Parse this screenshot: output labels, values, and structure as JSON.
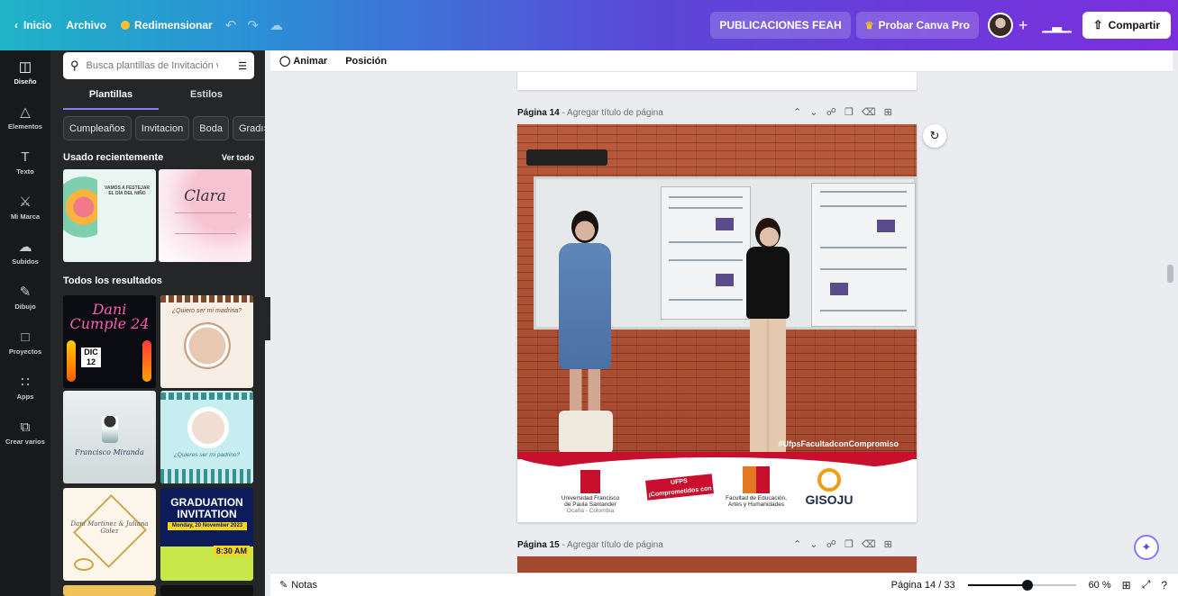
{
  "topbar": {
    "home": "Inicio",
    "file": "Archivo",
    "resize": "Redimensionar",
    "undo_icon": "undo-icon",
    "redo_icon": "redo-icon",
    "save_icon": "cloud-check-icon",
    "project_name": "PUBLICACIONES FEAH",
    "pro": "Probar Canva Pro",
    "share": "Compartir",
    "accent_gradient": [
      "#1fb3c7",
      "#5b47d8",
      "#7b2fdc"
    ]
  },
  "rail": {
    "items": [
      {
        "label": "Diseño",
        "icon": "layout-icon"
      },
      {
        "label": "Elementos",
        "icon": "shapes-icon"
      },
      {
        "label": "Texto",
        "icon": "text-icon"
      },
      {
        "label": "Mi Marca",
        "icon": "brand-icon"
      },
      {
        "label": "Subidos",
        "icon": "upload-icon"
      },
      {
        "label": "Dibujo",
        "icon": "draw-icon"
      },
      {
        "label": "Proyectos",
        "icon": "folder-icon"
      },
      {
        "label": "Apps",
        "icon": "apps-icon"
      },
      {
        "label": "Crear varios",
        "icon": "create-multiple-icon"
      }
    ]
  },
  "panel": {
    "search_placeholder": "Busca plantillas de Invitación virtu",
    "tabs": [
      "Plantillas",
      "Estilos"
    ],
    "chips": [
      "Cumpleaños",
      "Invitacion",
      "Boda",
      "Gradı"
    ],
    "recent_title": "Usado recientemente",
    "see_all": "Ver todo",
    "all_results": "Todos los resultados",
    "thumbs": {
      "invite_text": "VAMOS A FESTEJAR EL DÍA DEL NIÑO",
      "clara": "Clara",
      "dani": "Dani Cumple 24",
      "dani_date": "DIC 12",
      "quieres": "¿Quiero ser mi madrina?",
      "fig_name": "Francisco Miranda",
      "padrino": "¿Quieres ser mi padrino?",
      "wedding": "Dani Martinez & Juliana Golez",
      "grad": "GRADUATION INVITATION",
      "grad_date": "Monday, 20 November 2023",
      "grad_time": "8:30 AM"
    }
  },
  "context": {
    "animate": "Animar",
    "position": "Posición"
  },
  "canvas": {
    "page14_label": "Página 14",
    "page15_label": "Página 15",
    "add_title": "- Agregar título de página",
    "hashtag": "#UfpsFacultadconCompromiso",
    "logo_ufps": "Universidad Francisco de Paula Santander",
    "logo_ufps_sub": "Ocaña - Colombia",
    "logo_acr": "UFPS ¡Comprometidos con la ACREDITACIÓN!",
    "logo_feah": "Facultad de Educación, Artes y Humanidades",
    "logo_gis": "GISOJU"
  },
  "bottombar": {
    "notes": "Notas",
    "page_indicator": "Página 14 / 33",
    "zoom": "60 %",
    "zoom_fraction": 0.55
  }
}
